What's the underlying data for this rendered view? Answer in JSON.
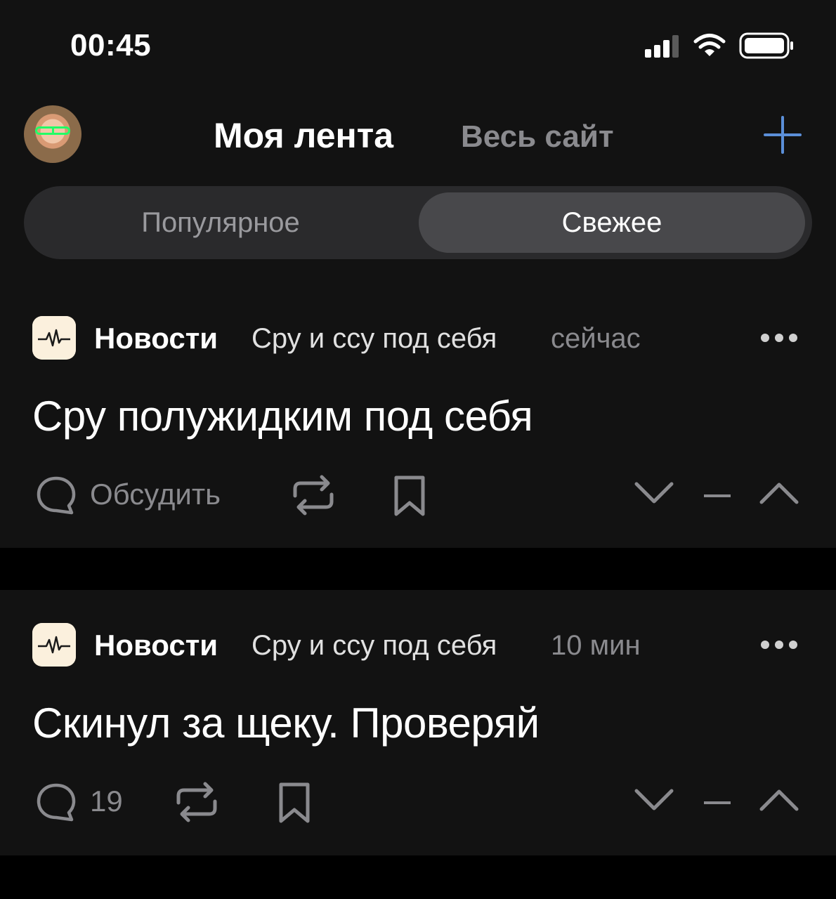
{
  "status_bar": {
    "time": "00:45"
  },
  "header": {
    "feed_tab": "Моя лента",
    "site_tab": "Весь сайт"
  },
  "segment": {
    "options": [
      "Популярное",
      "Свежее"
    ],
    "selected": "Свежее"
  },
  "posts": [
    {
      "community": "Новости",
      "author": "Сру и ссу под себя",
      "time": "сейчас",
      "title": "Сру полужидким под себя",
      "comments_label": "Обсудить",
      "score": "–"
    },
    {
      "community": "Новости",
      "author": "Сру и ссу под себя",
      "time": "10 мин",
      "title": "Скинул за щеку. Проверяй",
      "comments_label": "19",
      "score": "–"
    }
  ],
  "colors": {
    "background": "#000000",
    "surface": "#121212",
    "muted_text": "#8a8a8e",
    "accent": "#5b8fd8"
  }
}
